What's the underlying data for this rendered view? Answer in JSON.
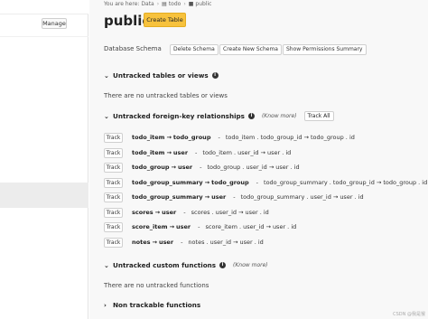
{
  "sidebar": {
    "manage_label": "Manage"
  },
  "breadcrumb": {
    "prefix": "You are here:",
    "items": [
      "Data",
      "todo",
      "public"
    ]
  },
  "page": {
    "title": "public",
    "create_table_label": "Create Table"
  },
  "schema": {
    "label": "Database Schema",
    "buttons": [
      "Delete Schema",
      "Create New Schema",
      "Show Permissions Summary"
    ]
  },
  "untracked_tables": {
    "title": "Untracked tables or views",
    "empty": "There are no untracked tables or views"
  },
  "untracked_fk": {
    "title": "Untracked foreign-key relationships",
    "know_more": "(Know more)",
    "track_all": "Track All",
    "track_label": "Track",
    "rows": [
      {
        "name_from": "todo_item",
        "name_to": "todo_group",
        "detail_from": "todo_item . todo_group_id",
        "detail_to": "todo_group . id"
      },
      {
        "name_from": "todo_item",
        "name_to": "user",
        "detail_from": "todo_item . user_id",
        "detail_to": "user . id"
      },
      {
        "name_from": "todo_group",
        "name_to": "user",
        "detail_from": "todo_group . user_id",
        "detail_to": "user . id"
      },
      {
        "name_from": "todo_group_summary",
        "name_to": "todo_group",
        "detail_from": "todo_group_summary . todo_group_id",
        "detail_to": "todo_group . id"
      },
      {
        "name_from": "todo_group_summary",
        "name_to": "user",
        "detail_from": "todo_group_summary . user_id",
        "detail_to": "user . id"
      },
      {
        "name_from": "scores",
        "name_to": "user",
        "detail_from": "scores . user_id",
        "detail_to": "user . id"
      },
      {
        "name_from": "score_item",
        "name_to": "user",
        "detail_from": "score_item . user_id",
        "detail_to": "user . id"
      },
      {
        "name_from": "notes",
        "name_to": "user",
        "detail_from": "notes . user_id",
        "detail_to": "user . id"
      }
    ]
  },
  "custom_functions": {
    "title": "Untracked custom functions",
    "know_more": "(Know more)",
    "empty": "There are no untracked functions"
  },
  "non_trackable": {
    "title": "Non trackable functions"
  },
  "watermark": "CSDN @我是猴",
  "colors": {
    "accent": "#f7c23d",
    "main_bg": "#f8f8f8"
  }
}
